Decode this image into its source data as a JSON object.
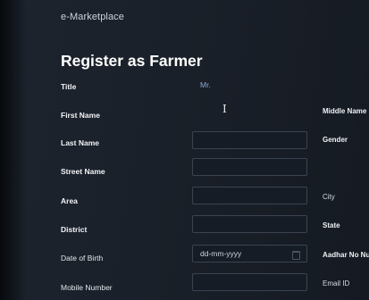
{
  "app": {
    "brand": "e-Marketplace"
  },
  "form": {
    "heading": "Register as Farmer",
    "title_label": "Title",
    "title_value": "Mr.",
    "first_name_label": "First Name",
    "last_name_label": "Last Name",
    "street_name_label": "Street Name",
    "area_label": "Area",
    "district_label": "District",
    "dob_label": "Date of Birth",
    "dob_placeholder": "dd-mm-yyyy",
    "mobile_label": "Mobile Number",
    "middle_name_label": "Middle Name",
    "gender_label": "Gender",
    "city_label": "City",
    "state_label": "State",
    "aadhar_label": "Aadhar No Nu",
    "email_label": "Email ID"
  },
  "icons": {
    "cursor": "text-cursor-icon",
    "calendar": "calendar-icon"
  }
}
